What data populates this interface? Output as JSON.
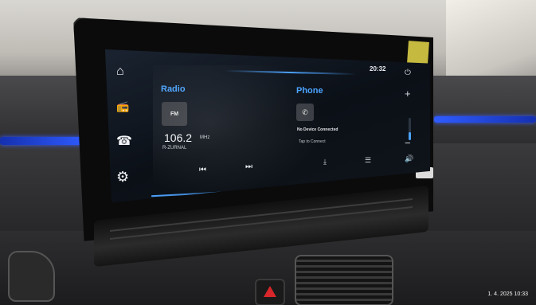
{
  "status_bar": {
    "time": "20:32"
  },
  "sidebar": {
    "items": [
      {
        "name": "home",
        "icon": "home-icon",
        "glyph": "⌂"
      },
      {
        "name": "radio",
        "icon": "radio-icon",
        "glyph": "📻"
      },
      {
        "name": "phone",
        "icon": "phone-icon",
        "glyph": "☎"
      },
      {
        "name": "settings",
        "icon": "gear-icon",
        "glyph": "⚙"
      }
    ]
  },
  "radio": {
    "title": "Radio",
    "band": "FM",
    "frequency": "106.2",
    "unit": "MHz",
    "station": "R-ZURNAL",
    "prev_glyph": "⏮",
    "next_glyph": "⏭"
  },
  "phone": {
    "title": "Phone",
    "glyph": "✆",
    "status": "No Device Connected",
    "hint": "Tap to Connect",
    "download_glyph": "⤓",
    "list_glyph": "☰"
  },
  "right_rail": {
    "power_glyph": "⏻",
    "plus_glyph": "+",
    "minus_glyph": "−",
    "speaker_glyph": "🔊",
    "volume_level": 0.35
  },
  "photo": {
    "timestamp": "1. 4. 2025 10:33"
  },
  "colors": {
    "accent": "#4aa3ff",
    "ambient": "#2f5cff"
  }
}
